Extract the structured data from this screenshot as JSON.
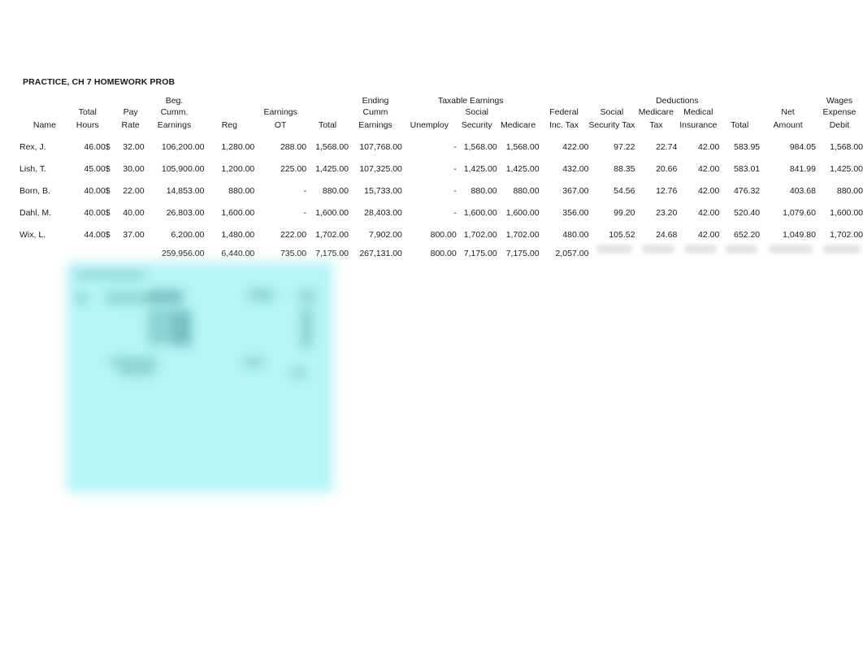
{
  "document": {
    "title": "PRACTICE, CH 7 HOMEWORK PROB"
  },
  "table": {
    "group_headers": {
      "taxable_earnings": "Taxable Earnings",
      "deductions": "Deductions"
    },
    "headers": {
      "name": {
        "l1": "",
        "l2": "",
        "l3": "Name"
      },
      "total_hours": {
        "l1": "",
        "l2": "Total",
        "l3": "Hours"
      },
      "currency": {
        "l1": "",
        "l2": "",
        "l3": ""
      },
      "pay_rate": {
        "l1": "",
        "l2": "Pay",
        "l3": "Rate"
      },
      "beg_cumm_earnings": {
        "l1": "Beg.",
        "l2": "Cumm.",
        "l3": "Earnings"
      },
      "reg": {
        "l1": "",
        "l2": "",
        "l3": "Reg"
      },
      "ot": {
        "l1": "",
        "l2": "Earnings",
        "l3": "OT"
      },
      "total_earnings": {
        "l1": "",
        "l2": "",
        "l3": "Total"
      },
      "ending_cumm_earnings": {
        "l1": "Ending",
        "l2": "Cumm",
        "l3": "Earnings"
      },
      "unemploy": {
        "l1": "",
        "l2": "",
        "l3": "Unemploy"
      },
      "social_security": {
        "l1": "",
        "l2": "Social",
        "l3": "Security"
      },
      "medicare": {
        "l1": "",
        "l2": "",
        "l3": "Medicare"
      },
      "federal_inc_tax": {
        "l1": "",
        "l2": "Federal",
        "l3": "Inc. Tax"
      },
      "social_security_tax": {
        "l1": "",
        "l2": "Social",
        "l3": "Security Tax"
      },
      "medicare_tax": {
        "l1": "",
        "l2": "Medicare",
        "l3": "Tax"
      },
      "medical_insurance": {
        "l1": "",
        "l2": "Medical",
        "l3": "Insurance"
      },
      "deductions_total": {
        "l1": "",
        "l2": "",
        "l3": "Total"
      },
      "net_amount": {
        "l1": "",
        "l2": "Net",
        "l3": "Amount"
      },
      "wages_expense_debit": {
        "l1": "Wages",
        "l2": "Expense",
        "l3": "Debit"
      }
    },
    "rows": [
      {
        "name": "Rex, J.",
        "total_hours": "46.00",
        "currency": "$",
        "pay_rate": "32.00",
        "beg_cumm_earnings": "106,200.00",
        "reg": "1,280.00",
        "ot": "288.00",
        "total_earnings": "1,568.00",
        "ending_cumm_earnings": "107,768.00",
        "unemploy": "-",
        "social_security": "1,568.00",
        "medicare": "1,568.00",
        "federal_inc_tax": "422.00",
        "social_security_tax": "97.22",
        "medicare_tax": "22.74",
        "medical_insurance": "42.00",
        "deductions_total": "583.95",
        "net_amount": "984.05",
        "wages_expense_debit": "1,568.00"
      },
      {
        "name": "Lish, T.",
        "total_hours": "45.00",
        "currency": "$",
        "pay_rate": "30.00",
        "beg_cumm_earnings": "105,900.00",
        "reg": "1,200.00",
        "ot": "225.00",
        "total_earnings": "1,425.00",
        "ending_cumm_earnings": "107,325.00",
        "unemploy": "-",
        "social_security": "1,425.00",
        "medicare": "1,425.00",
        "federal_inc_tax": "432.00",
        "social_security_tax": "88.35",
        "medicare_tax": "20.66",
        "medical_insurance": "42.00",
        "deductions_total": "583.01",
        "net_amount": "841.99",
        "wages_expense_debit": "1,425.00"
      },
      {
        "name": "Born, B.",
        "total_hours": "40.00",
        "currency": "$",
        "pay_rate": "22.00",
        "beg_cumm_earnings": "14,853.00",
        "reg": "880.00",
        "ot": "-",
        "total_earnings": "880.00",
        "ending_cumm_earnings": "15,733.00",
        "unemploy": "-",
        "social_security": "880.00",
        "medicare": "880.00",
        "federal_inc_tax": "367.00",
        "social_security_tax": "54.56",
        "medicare_tax": "12.76",
        "medical_insurance": "42.00",
        "deductions_total": "476.32",
        "net_amount": "403.68",
        "wages_expense_debit": "880.00"
      },
      {
        "name": "Dahl, M.",
        "total_hours": "40.00",
        "currency": "$",
        "pay_rate": "40.00",
        "beg_cumm_earnings": "26,803.00",
        "reg": "1,600.00",
        "ot": "-",
        "total_earnings": "1,600.00",
        "ending_cumm_earnings": "28,403.00",
        "unemploy": "-",
        "social_security": "1,600.00",
        "medicare": "1,600.00",
        "federal_inc_tax": "356.00",
        "social_security_tax": "99.20",
        "medicare_tax": "23.20",
        "medical_insurance": "42.00",
        "deductions_total": "520.40",
        "net_amount": "1,079.60",
        "wages_expense_debit": "1,600.00"
      },
      {
        "name": "Wix, L.",
        "total_hours": "44.00",
        "currency": "$",
        "pay_rate": "37.00",
        "beg_cumm_earnings": "6,200.00",
        "reg": "1,480.00",
        "ot": "222.00",
        "total_earnings": "1,702.00",
        "ending_cumm_earnings": "7,902.00",
        "unemploy": "800.00",
        "social_security": "1,702.00",
        "medicare": "1,702.00",
        "federal_inc_tax": "480.00",
        "social_security_tax": "105.52",
        "medicare_tax": "24.68",
        "medical_insurance": "42.00",
        "deductions_total": "652.20",
        "net_amount": "1,049.80",
        "wages_expense_debit": "1,702.00"
      }
    ],
    "totals": {
      "name": "",
      "total_hours": "",
      "currency": "",
      "pay_rate": "",
      "beg_cumm_earnings": "259,956.00",
      "reg": "6,440.00",
      "ot": "735.00",
      "total_earnings": "7,175.00",
      "ending_cumm_earnings": "267,131.00",
      "unemploy": "800.00",
      "social_security": "7,175.00",
      "medicare": "7,175.00",
      "federal_inc_tax": "2,057.00",
      "social_security_tax": "",
      "medicare_tax": "",
      "medical_insurance": "",
      "deductions_total": "",
      "net_amount": "",
      "wages_expense_debit": ""
    }
  },
  "blurred_panel": {
    "note": "",
    "fill_color": "#b3f4f7"
  }
}
